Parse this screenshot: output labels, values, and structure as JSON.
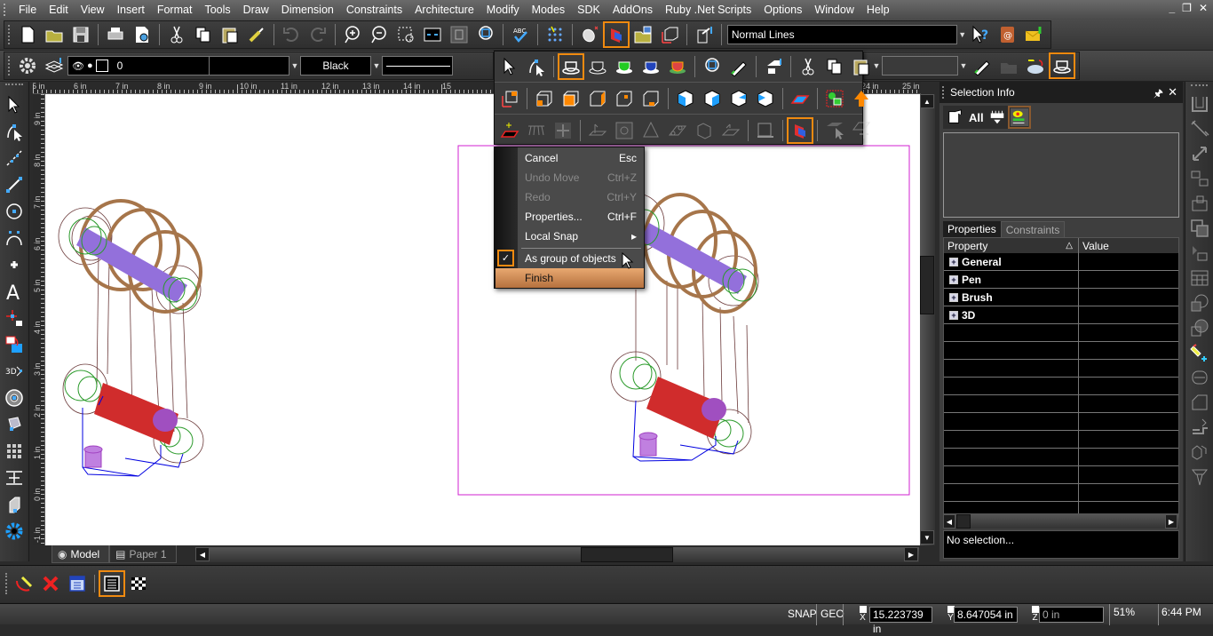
{
  "menubar": {
    "items": [
      "File",
      "Edit",
      "View",
      "Insert",
      "Format",
      "Tools",
      "Draw",
      "Dimension",
      "Constraints",
      "Architecture",
      "Modify",
      "Modes",
      "SDK",
      "AddOns",
      "Ruby .Net Scripts",
      "Options",
      "Window",
      "Help"
    ],
    "window_controls": [
      "_",
      "restore",
      "X"
    ]
  },
  "toolbar_main": {
    "icons": [
      "new-file",
      "open-folder",
      "save",
      "print",
      "print-preview",
      "cut",
      "copy",
      "paste",
      "format-painter",
      "undo",
      "redo",
      "zoom-in",
      "zoom-out",
      "zoom-window",
      "zoom-extents",
      "zoom-page",
      "zoom-selection",
      "spell-check",
      "snap-grid",
      "smart-mouse",
      "3d-section-active",
      "open-file-2",
      "3d-view",
      "import-export"
    ],
    "line_style_value": "Normal Lines"
  },
  "toolbar_props": {
    "layer_value": "0",
    "color_value": "Black",
    "linetype_value": ""
  },
  "context_menu": {
    "items": [
      {
        "label": "Cancel",
        "shortcut": "Esc",
        "enabled": true
      },
      {
        "label": "Undo Move",
        "shortcut": "Ctrl+Z",
        "enabled": false
      },
      {
        "label": "Redo",
        "shortcut": "Ctrl+Y",
        "enabled": false
      },
      {
        "label": "Properties...",
        "shortcut": "Ctrl+F",
        "enabled": true
      },
      {
        "label": "Local Snap",
        "shortcut": "▸",
        "enabled": true
      },
      {
        "label": "As group of objects",
        "shortcut": "",
        "enabled": true,
        "checked": true
      },
      {
        "label": "Finish",
        "shortcut": "",
        "enabled": true,
        "highlighted": true
      }
    ]
  },
  "rulers": {
    "horizontal": [
      "5 in",
      "6 in",
      "7 in",
      "8 in",
      "9 in",
      "10 in",
      "11 in",
      "12 in",
      "13 in",
      "14 in",
      "15",
      "24 in",
      "25 in"
    ],
    "vertical": [
      "9 in",
      "8 in",
      "7 in",
      "6 in",
      "5 in",
      "4 in",
      "3 in",
      "2 in",
      "1 in",
      "0 in",
      "-1 in"
    ]
  },
  "tabs": [
    {
      "label": "Model",
      "active": true
    },
    {
      "label": "Paper 1",
      "active": false
    }
  ],
  "selection_panel": {
    "title": "Selection Info",
    "tool_labels": [
      "All"
    ],
    "prop_tabs": [
      "Properties",
      "Constraints"
    ],
    "grid_headers": [
      "Property",
      "Value"
    ],
    "groups": [
      "General",
      "Pen",
      "Brush",
      "3D"
    ],
    "description": "No selection..."
  },
  "status": {
    "snap": "SNAP",
    "geo": "GEO",
    "x_label": "X",
    "x_value": "15.223739 in",
    "y_label": "Y",
    "y_value": "8.647054 in",
    "z_label": "Z",
    "z_value": "0 in",
    "zoom": "51%",
    "time": "6:44 PM"
  },
  "colors": {
    "accent": "#f08a10",
    "menu_highlight": "#c68350",
    "selection_frame": "#d020d0"
  }
}
